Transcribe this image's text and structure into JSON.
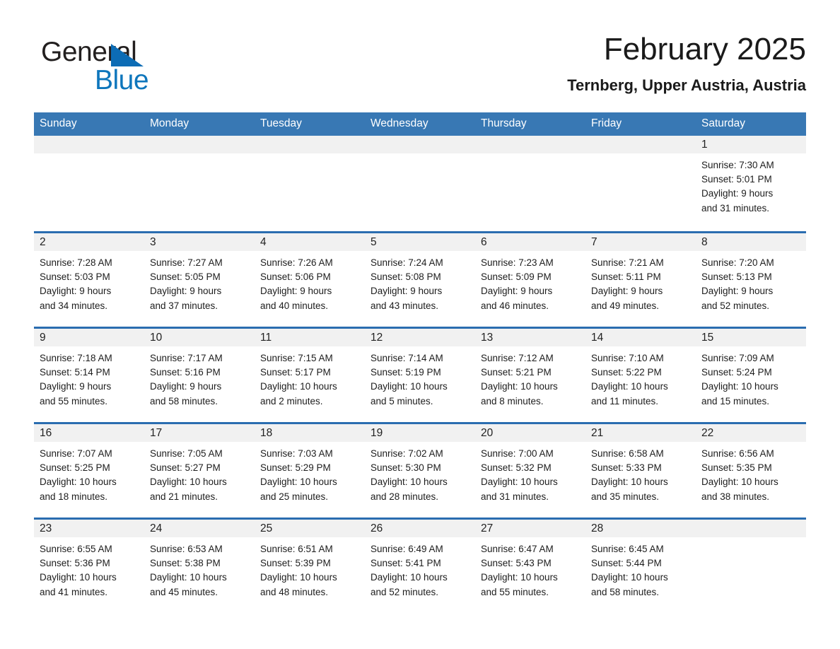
{
  "brand": {
    "word1": "General",
    "word2": "Blue",
    "triangle_color": "#0c6cb5",
    "blue_text_color": "#0e76bc"
  },
  "header": {
    "title": "February 2025",
    "subtitle": "Ternberg, Upper Austria, Austria"
  },
  "theme": {
    "header_bar": "#3878b4",
    "cell_top_rule": "#2a6db0",
    "daynum_bg": "#f1f1f1"
  },
  "weekday_headers": [
    "Sunday",
    "Monday",
    "Tuesday",
    "Wednesday",
    "Thursday",
    "Friday",
    "Saturday"
  ],
  "weeks": [
    [
      {
        "day": "",
        "empty": true
      },
      {
        "day": "",
        "empty": true
      },
      {
        "day": "",
        "empty": true
      },
      {
        "day": "",
        "empty": true
      },
      {
        "day": "",
        "empty": true
      },
      {
        "day": "",
        "empty": true
      },
      {
        "day": "1",
        "sunrise": "Sunrise: 7:30 AM",
        "sunset": "Sunset: 5:01 PM",
        "daylight1": "Daylight: 9 hours",
        "daylight2": "and 31 minutes."
      }
    ],
    [
      {
        "day": "2",
        "sunrise": "Sunrise: 7:28 AM",
        "sunset": "Sunset: 5:03 PM",
        "daylight1": "Daylight: 9 hours",
        "daylight2": "and 34 minutes."
      },
      {
        "day": "3",
        "sunrise": "Sunrise: 7:27 AM",
        "sunset": "Sunset: 5:05 PM",
        "daylight1": "Daylight: 9 hours",
        "daylight2": "and 37 minutes."
      },
      {
        "day": "4",
        "sunrise": "Sunrise: 7:26 AM",
        "sunset": "Sunset: 5:06 PM",
        "daylight1": "Daylight: 9 hours",
        "daylight2": "and 40 minutes."
      },
      {
        "day": "5",
        "sunrise": "Sunrise: 7:24 AM",
        "sunset": "Sunset: 5:08 PM",
        "daylight1": "Daylight: 9 hours",
        "daylight2": "and 43 minutes."
      },
      {
        "day": "6",
        "sunrise": "Sunrise: 7:23 AM",
        "sunset": "Sunset: 5:09 PM",
        "daylight1": "Daylight: 9 hours",
        "daylight2": "and 46 minutes."
      },
      {
        "day": "7",
        "sunrise": "Sunrise: 7:21 AM",
        "sunset": "Sunset: 5:11 PM",
        "daylight1": "Daylight: 9 hours",
        "daylight2": "and 49 minutes."
      },
      {
        "day": "8",
        "sunrise": "Sunrise: 7:20 AM",
        "sunset": "Sunset: 5:13 PM",
        "daylight1": "Daylight: 9 hours",
        "daylight2": "and 52 minutes."
      }
    ],
    [
      {
        "day": "9",
        "sunrise": "Sunrise: 7:18 AM",
        "sunset": "Sunset: 5:14 PM",
        "daylight1": "Daylight: 9 hours",
        "daylight2": "and 55 minutes."
      },
      {
        "day": "10",
        "sunrise": "Sunrise: 7:17 AM",
        "sunset": "Sunset: 5:16 PM",
        "daylight1": "Daylight: 9 hours",
        "daylight2": "and 58 minutes."
      },
      {
        "day": "11",
        "sunrise": "Sunrise: 7:15 AM",
        "sunset": "Sunset: 5:17 PM",
        "daylight1": "Daylight: 10 hours",
        "daylight2": "and 2 minutes."
      },
      {
        "day": "12",
        "sunrise": "Sunrise: 7:14 AM",
        "sunset": "Sunset: 5:19 PM",
        "daylight1": "Daylight: 10 hours",
        "daylight2": "and 5 minutes."
      },
      {
        "day": "13",
        "sunrise": "Sunrise: 7:12 AM",
        "sunset": "Sunset: 5:21 PM",
        "daylight1": "Daylight: 10 hours",
        "daylight2": "and 8 minutes."
      },
      {
        "day": "14",
        "sunrise": "Sunrise: 7:10 AM",
        "sunset": "Sunset: 5:22 PM",
        "daylight1": "Daylight: 10 hours",
        "daylight2": "and 11 minutes."
      },
      {
        "day": "15",
        "sunrise": "Sunrise: 7:09 AM",
        "sunset": "Sunset: 5:24 PM",
        "daylight1": "Daylight: 10 hours",
        "daylight2": "and 15 minutes."
      }
    ],
    [
      {
        "day": "16",
        "sunrise": "Sunrise: 7:07 AM",
        "sunset": "Sunset: 5:25 PM",
        "daylight1": "Daylight: 10 hours",
        "daylight2": "and 18 minutes."
      },
      {
        "day": "17",
        "sunrise": "Sunrise: 7:05 AM",
        "sunset": "Sunset: 5:27 PM",
        "daylight1": "Daylight: 10 hours",
        "daylight2": "and 21 minutes."
      },
      {
        "day": "18",
        "sunrise": "Sunrise: 7:03 AM",
        "sunset": "Sunset: 5:29 PM",
        "daylight1": "Daylight: 10 hours",
        "daylight2": "and 25 minutes."
      },
      {
        "day": "19",
        "sunrise": "Sunrise: 7:02 AM",
        "sunset": "Sunset: 5:30 PM",
        "daylight1": "Daylight: 10 hours",
        "daylight2": "and 28 minutes."
      },
      {
        "day": "20",
        "sunrise": "Sunrise: 7:00 AM",
        "sunset": "Sunset: 5:32 PM",
        "daylight1": "Daylight: 10 hours",
        "daylight2": "and 31 minutes."
      },
      {
        "day": "21",
        "sunrise": "Sunrise: 6:58 AM",
        "sunset": "Sunset: 5:33 PM",
        "daylight1": "Daylight: 10 hours",
        "daylight2": "and 35 minutes."
      },
      {
        "day": "22",
        "sunrise": "Sunrise: 6:56 AM",
        "sunset": "Sunset: 5:35 PM",
        "daylight1": "Daylight: 10 hours",
        "daylight2": "and 38 minutes."
      }
    ],
    [
      {
        "day": "23",
        "sunrise": "Sunrise: 6:55 AM",
        "sunset": "Sunset: 5:36 PM",
        "daylight1": "Daylight: 10 hours",
        "daylight2": "and 41 minutes."
      },
      {
        "day": "24",
        "sunrise": "Sunrise: 6:53 AM",
        "sunset": "Sunset: 5:38 PM",
        "daylight1": "Daylight: 10 hours",
        "daylight2": "and 45 minutes."
      },
      {
        "day": "25",
        "sunrise": "Sunrise: 6:51 AM",
        "sunset": "Sunset: 5:39 PM",
        "daylight1": "Daylight: 10 hours",
        "daylight2": "and 48 minutes."
      },
      {
        "day": "26",
        "sunrise": "Sunrise: 6:49 AM",
        "sunset": "Sunset: 5:41 PM",
        "daylight1": "Daylight: 10 hours",
        "daylight2": "and 52 minutes."
      },
      {
        "day": "27",
        "sunrise": "Sunrise: 6:47 AM",
        "sunset": "Sunset: 5:43 PM",
        "daylight1": "Daylight: 10 hours",
        "daylight2": "and 55 minutes."
      },
      {
        "day": "28",
        "sunrise": "Sunrise: 6:45 AM",
        "sunset": "Sunset: 5:44 PM",
        "daylight1": "Daylight: 10 hours",
        "daylight2": "and 58 minutes."
      },
      {
        "day": "",
        "empty": true
      }
    ]
  ]
}
